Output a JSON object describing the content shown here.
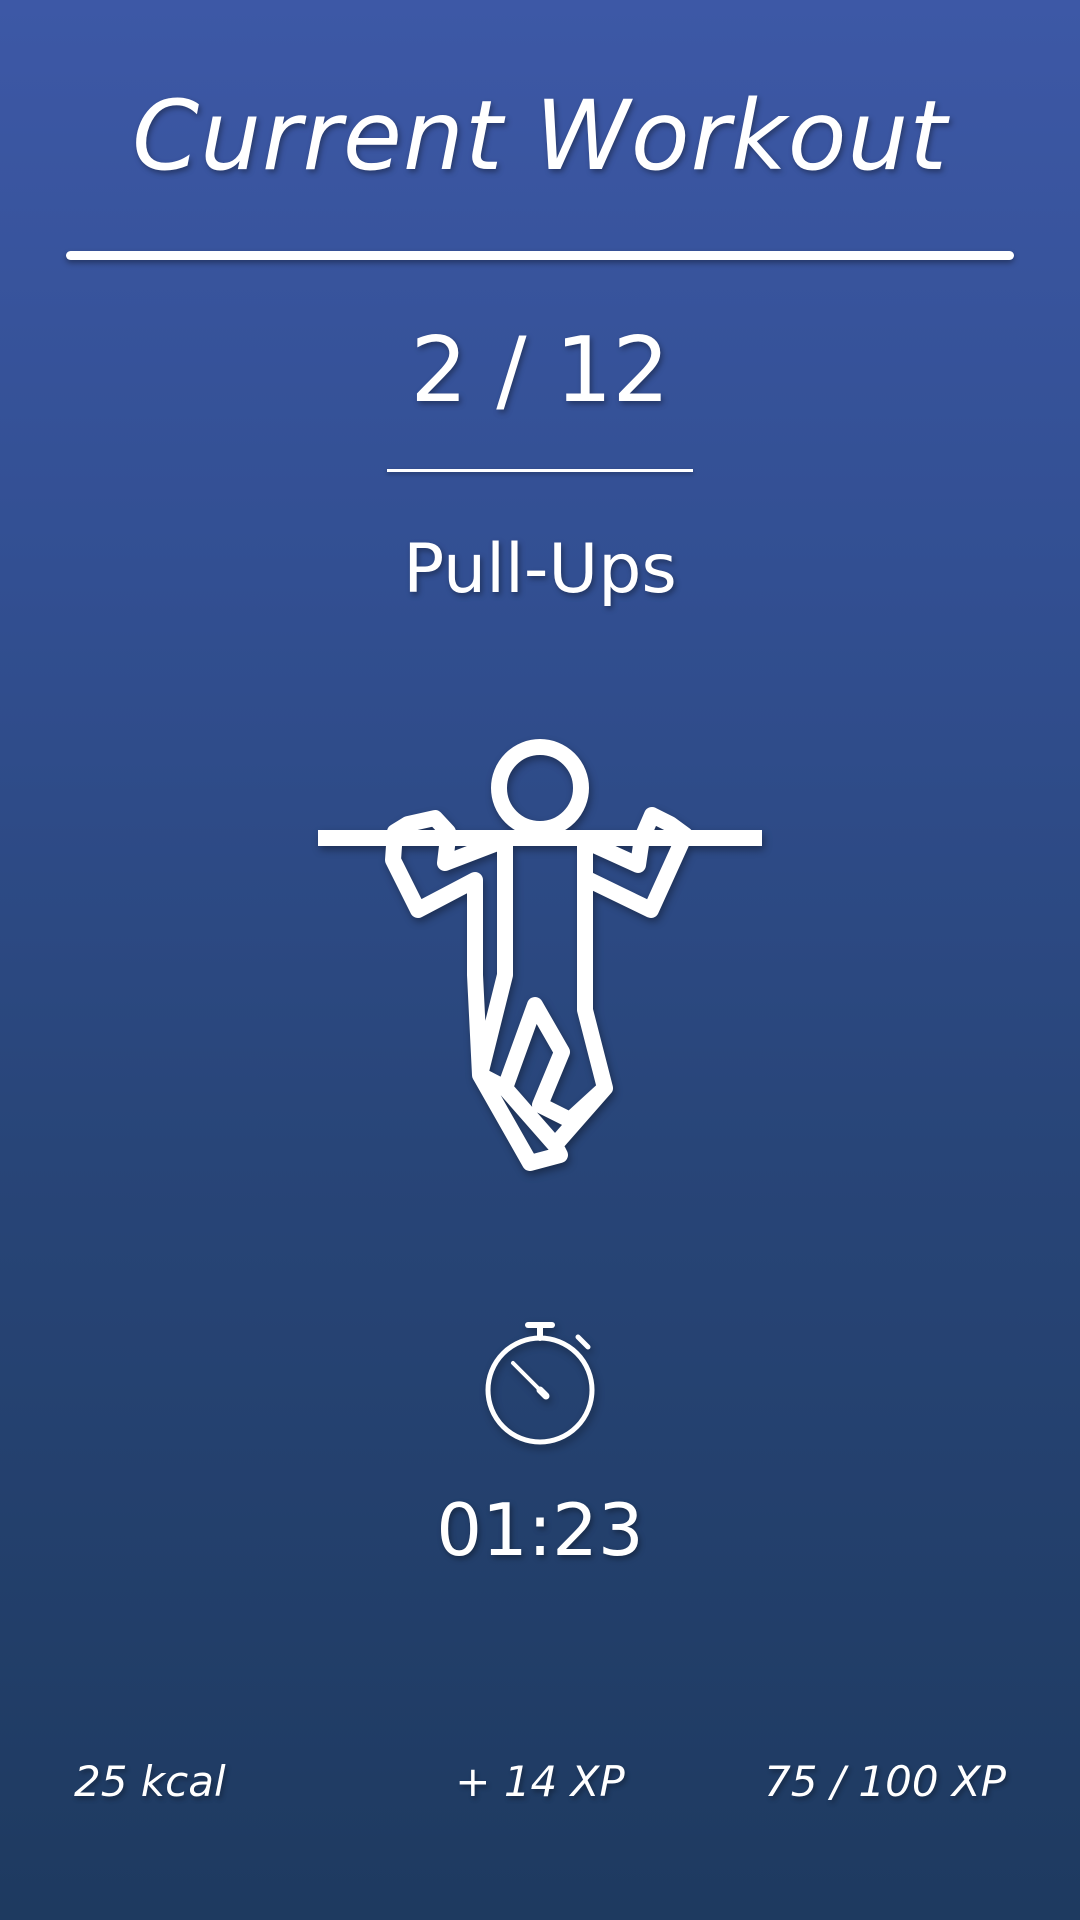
{
  "header": {
    "title": "Current Workout"
  },
  "progress": {
    "label": "2 / 12",
    "current": 2,
    "total": 12
  },
  "exercise": {
    "name": "Pull-Ups",
    "icon": "pull-up-figure-icon"
  },
  "timer": {
    "icon": "stopwatch-icon",
    "value": "01:23"
  },
  "stats": {
    "calories": "25 kcal",
    "xp_gain": "+ 14 XP",
    "xp_level": "75 / 100 XP"
  },
  "colors": {
    "background_top": "#3d58a6",
    "background_bottom": "#1e3a60",
    "foreground": "#ffffff"
  }
}
